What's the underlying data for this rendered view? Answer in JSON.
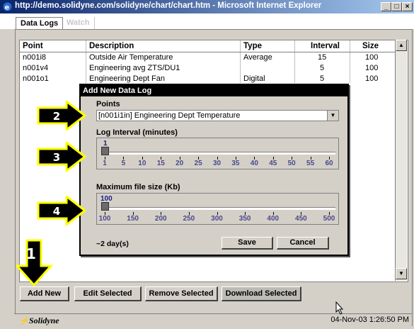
{
  "window": {
    "title": "http://demo.solidyne.com/solidyne/chart/chart.htm - Microsoft Internet Explorer"
  },
  "tabs": [
    {
      "label": "Data Logs"
    },
    {
      "label": "Watch"
    }
  ],
  "table": {
    "columns": [
      "Point",
      "Description",
      "Type",
      "Interval",
      "Size"
    ],
    "rows": [
      [
        "n001i8",
        "Outside Air Temperature",
        "Average",
        "15",
        "100"
      ],
      [
        "n001v4",
        "Engineering avg ZTS/DU1",
        "",
        "5",
        "100"
      ],
      [
        "n001o1",
        "Engineering Dept Fan",
        "Digital",
        "5",
        "100"
      ]
    ]
  },
  "dialog": {
    "title": "Add New Data Log",
    "points_label": "Points",
    "points_value": "[n001i1in] Engineering Dept Temperature",
    "interval_label": "Log Interval (minutes)",
    "interval_value": "1",
    "interval_ticks": [
      "1",
      "5",
      "10",
      "15",
      "20",
      "25",
      "30",
      "35",
      "40",
      "45",
      "50",
      "55",
      "60"
    ],
    "size_label": "Maximum file size (Kb)",
    "size_value": "100",
    "size_ticks": [
      "100",
      "150",
      "200",
      "250",
      "300",
      "350",
      "400",
      "450",
      "500"
    ],
    "estimate": "~2 day(s)",
    "save_label": "Save",
    "cancel_label": "Cancel"
  },
  "buttons": {
    "add_new": "Add New",
    "edit_selected": "Edit Selected",
    "remove_selected": "Remove Selected",
    "download_selected": "Download Selected"
  },
  "status": {
    "logo": "Solidyne",
    "timestamp": "04-Nov-03 1:26:50 PM"
  },
  "annotations": [
    "1",
    "2",
    "3",
    "4"
  ],
  "colors": {
    "titlebar": "#0a246a",
    "annotation_fill": "#ffff00",
    "annotation_arrow": "#000000"
  }
}
